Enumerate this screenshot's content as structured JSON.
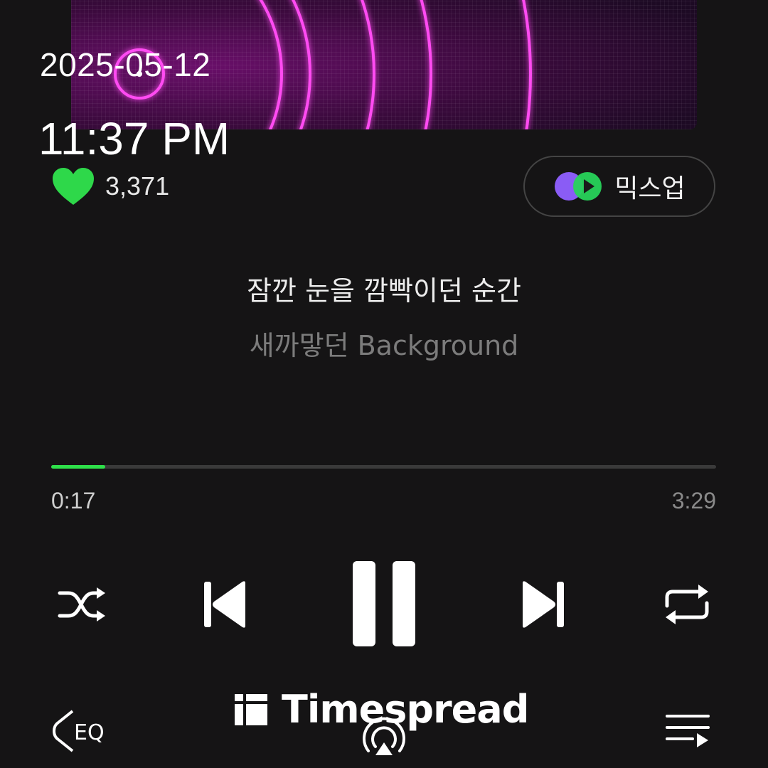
{
  "overlay": {
    "date": "2025-05-12",
    "time": "11:37 PM"
  },
  "player": {
    "like_count": "3,371",
    "mixup_label": "믹스업",
    "lyrics": {
      "current": "잠깐 눈을 깜빡이던 순간",
      "next": "새까맣던 Background"
    },
    "elapsed": "0:17",
    "duration": "3:29",
    "progress_fraction": 0.081,
    "eq_label": "EQ"
  },
  "watermark": {
    "text": "Timespread"
  },
  "colors": {
    "accent": "#2ee04a",
    "background": "#151415",
    "art_glow": "#ff3df0"
  },
  "icons": [
    "heart-icon",
    "mixup-icon",
    "shuffle-icon",
    "previous-icon",
    "pause-icon",
    "next-icon",
    "repeat-icon",
    "eq-icon",
    "cast-icon",
    "playlist-icon"
  ]
}
